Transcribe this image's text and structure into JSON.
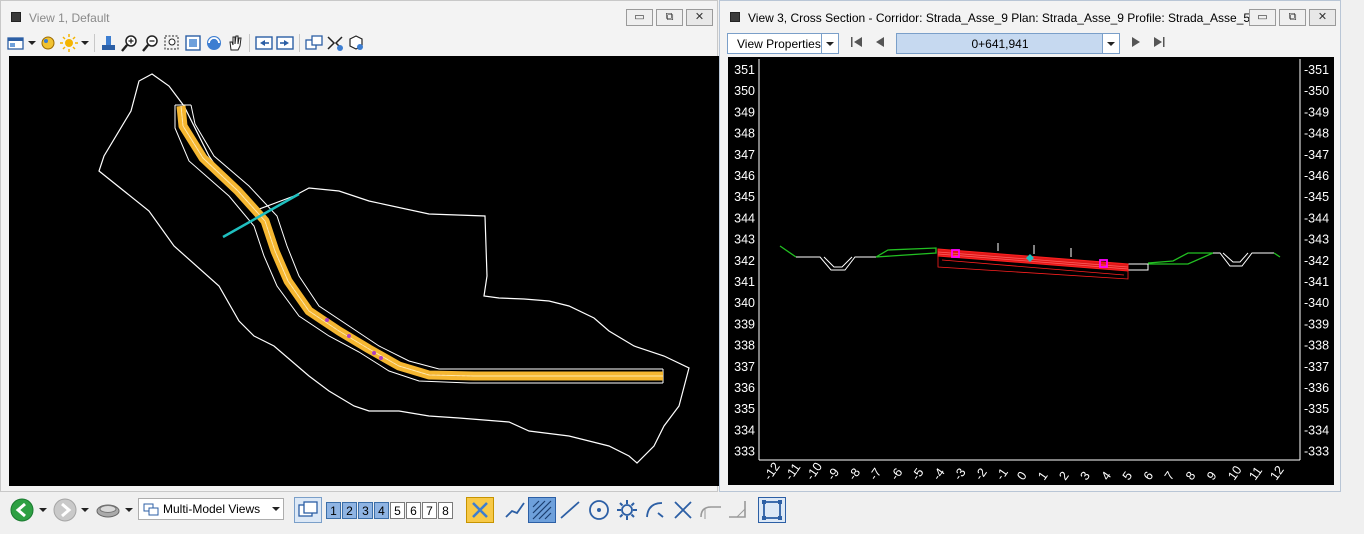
{
  "view1": {
    "title": "View 1, Default"
  },
  "view3": {
    "title": "View 3, Cross Section - Corridor: Strada_Asse_9 Plan: Strada_Asse_9 Profile: Strada_Asse_5",
    "view_properties_label": "View Properties",
    "station": "0+641,941",
    "y_ticks": [
      "351",
      "350",
      "349",
      "348",
      "347",
      "346",
      "345",
      "344",
      "343",
      "342",
      "341",
      "340",
      "339",
      "338",
      "337",
      "336",
      "335",
      "334",
      "333"
    ],
    "x_ticks": [
      "-12",
      "-11",
      "-10",
      "-9",
      "-8",
      "-7",
      "-6",
      "-5",
      "-4",
      "-3",
      "-2",
      "-1",
      "0",
      "1",
      "2",
      "3",
      "4",
      "5",
      "6",
      "7",
      "8",
      "9",
      "10",
      "11",
      "12"
    ]
  },
  "window_buttons": {
    "minimize": "▭",
    "restore": "⧉",
    "close": "✕"
  },
  "bottombar": {
    "model_views_label": "Multi-Model Views",
    "view_numbers": [
      "1",
      "2",
      "3",
      "4",
      "5",
      "6",
      "7",
      "8"
    ],
    "active_views": [
      true,
      true,
      true,
      true,
      false,
      false,
      false,
      false
    ]
  },
  "colors": {
    "canvas": "#000000",
    "alignment": "#f5b731",
    "cross_section_line": "#1fbfbf",
    "terrain": "#ffffff",
    "pavement": "#ff2020",
    "ground": "#22c022",
    "marker": "#ff00ff"
  }
}
